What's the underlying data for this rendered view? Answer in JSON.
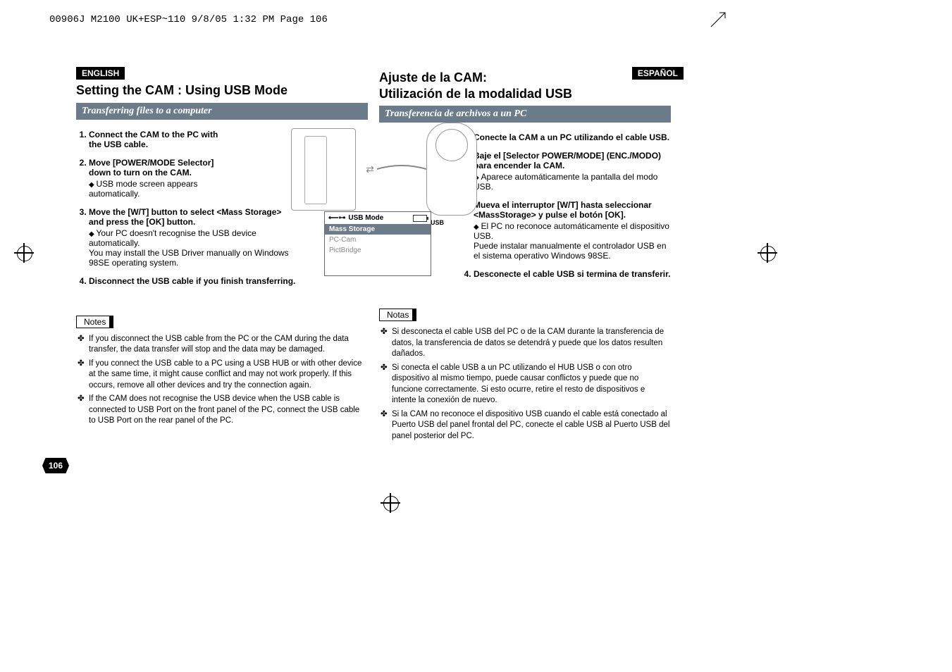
{
  "header_strip": "00906J M2100 UK+ESP~110  9/8/05 1:32 PM  Page 106",
  "page_number": "106",
  "left": {
    "lang": "ENGLISH",
    "title": "Setting the CAM : Using USB Mode",
    "section": "Transferring files to a computer",
    "steps": [
      {
        "head": "Connect the CAM to the PC with the USB cable.",
        "subs": []
      },
      {
        "head": "Move [POWER/MODE Selector] down to turn on the CAM.",
        "subs": [
          "USB mode screen appears automatically."
        ]
      },
      {
        "head": "Move the [W/T] button to select <Mass Storage>",
        "head2": "and press the [OK] button.",
        "subs": [
          "Your PC doesn't recognise the USB device automatically.\nYou may install the USB Driver manually on Windows 98SE operating system."
        ]
      },
      {
        "head": "Disconnect the USB cable if you finish transferring.",
        "subs": []
      }
    ],
    "notes_label": "Notes",
    "notes": [
      "If you disconnect the USB cable from the PC or the CAM during the data transfer, the data transfer will stop and the data may be damaged.",
      "If you connect the USB cable to a PC using a USB HUB or with other device at the same time, it might cause conflict and may not work properly. If this occurs, remove all other devices and try the connection again.",
      "If the CAM does not recognise the USB device when the USB cable is connected to USB Port on the front panel of the PC, connect the USB cable to USB Port on the rear panel of the PC."
    ]
  },
  "right": {
    "lang": "ESPAÑOL",
    "title_l1": "Ajuste de la CAM:",
    "title_l2": "Utilización de la modalidad USB",
    "section": "Transferencia de archivos a un PC",
    "steps": [
      {
        "head": "Conecte la CAM a un PC utilizando el cable USB.",
        "subs": []
      },
      {
        "head": "Baje el [Selector POWER/MODE] (ENC./MODO) para encender la CAM.",
        "subs": [
          "Aparece automáticamente la pantalla del modo USB."
        ]
      },
      {
        "head": "Mueva el interruptor [W/T] hasta seleccionar <MassStorage> y pulse el botón [OK].",
        "subs": [
          "El PC no reconoce automáticamente el dispositivo USB.\nPuede instalar manualmente el controlador USB en el sistema operativo Windows 98SE."
        ]
      },
      {
        "head": "Desconecte el cable USB si termina de transferir.",
        "subs": []
      }
    ],
    "notes_label": "Notas",
    "notes": [
      "Si desconecta el cable USB del PC o de la CAM durante la transferencia de datos, la transferencia de datos se detendrá y puede que los datos resulten dañados.",
      "Si conecta el cable USB a un PC utilizando el HUB USB o con otro dispositivo al mismo tiempo, puede causar conflictos y puede que no funcione correctamente. Si esto ocurre, retire el resto de dispositivos e intente la conexión de nuevo.",
      "Si la CAM no reconoce el dispositivo USB cuando el cable está conectado al Puerto USB del panel frontal del PC, conecte el cable USB al Puerto USB del panel posterior del PC."
    ]
  },
  "usb_screen": {
    "title": "USB Mode",
    "items": [
      "Mass Storage",
      "PC-Cam",
      "PictBridge"
    ],
    "selected_index": 0
  },
  "usb_label": "USB"
}
